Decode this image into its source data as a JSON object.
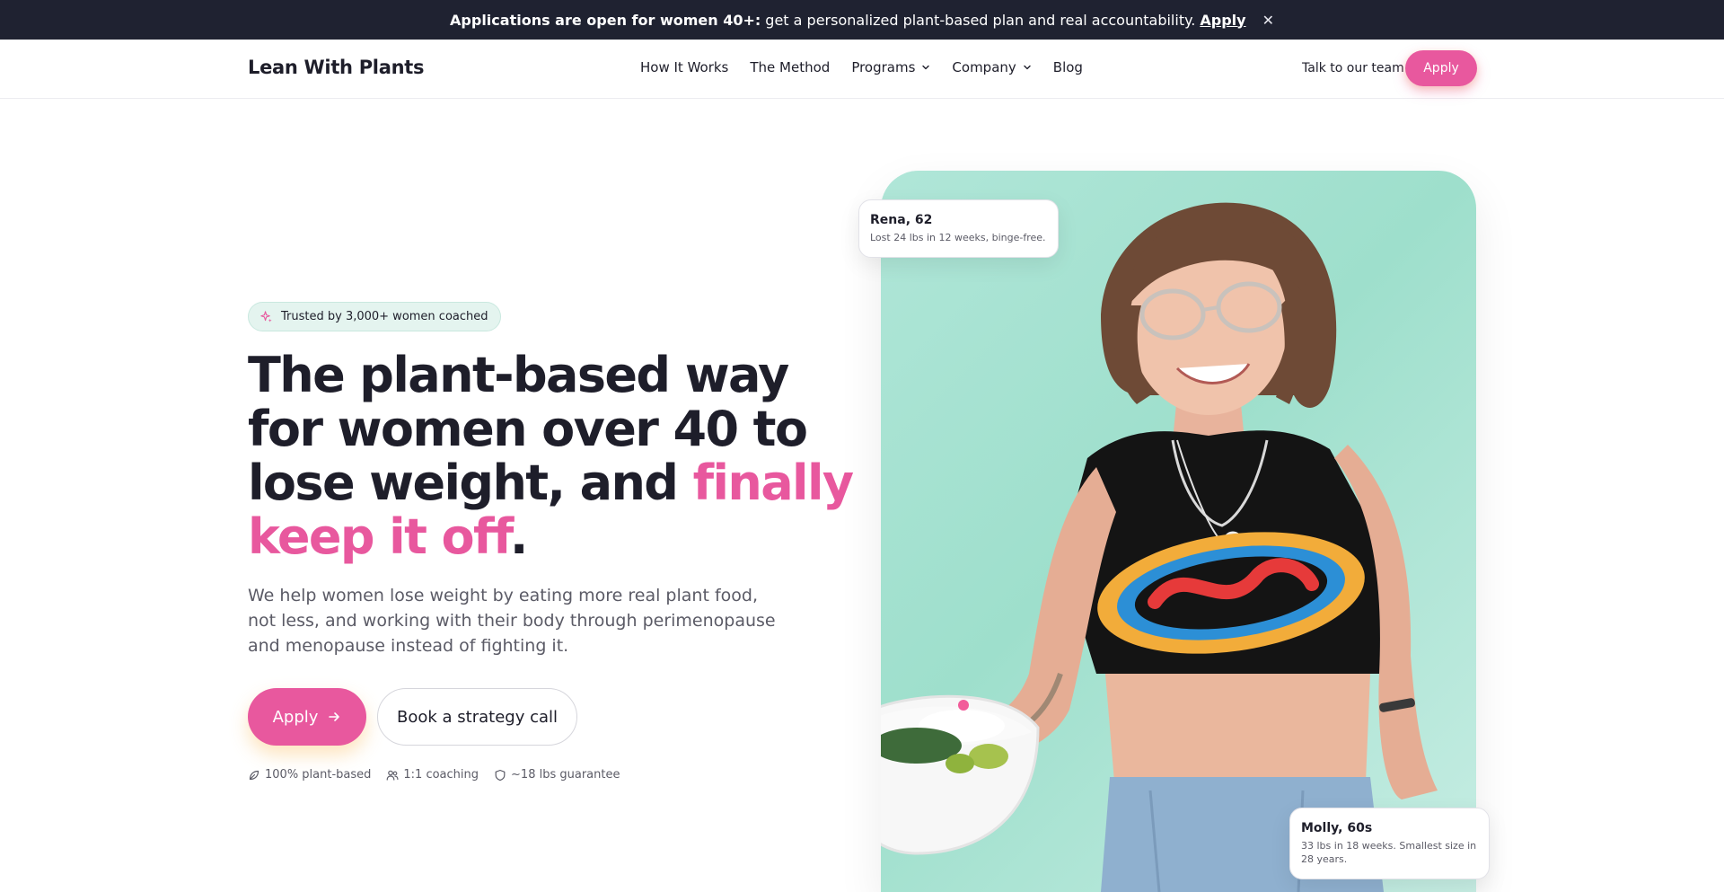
{
  "announcement": {
    "bold_text": "Applications are open for women 40+:",
    "text": "get a personalized plant-based plan and real accountability.",
    "link_label": "Apply",
    "close_label": "✕"
  },
  "header": {
    "logo": "Lean With Plants",
    "nav": [
      {
        "label": "How It Works"
      },
      {
        "label": "The Method"
      },
      {
        "label": "Programs"
      },
      {
        "label": "Company"
      },
      {
        "label": "Blog"
      }
    ],
    "talk_label": "Talk to our team",
    "apply_label": "Apply"
  },
  "hero": {
    "badge": "Trusted by 3,000+ women coached",
    "headline_part1": "The plant-based way for women over 40 to lose weight, and",
    "headline_accent": "finally keep it off",
    "headline_end": ".",
    "subtext": "We help women lose weight by eating more real plant food, not less, and working with their body through perimenopause and menopause instead of fighting it.",
    "apply_label": "Apply",
    "book_label": "Book a strategy call",
    "features": [
      {
        "icon": "leaf-icon",
        "label": "100% plant-based"
      },
      {
        "icon": "users-icon",
        "label": "1:1 coaching"
      },
      {
        "icon": "shield-icon",
        "label": "~18 lbs guarantee"
      }
    ]
  },
  "testimonials": {
    "top": {
      "name": "Rena, 62",
      "text": "Lost 24 lbs in 12 weeks, binge-free."
    },
    "bottom": {
      "name": "Molly, 60s",
      "text": "33 lbs in 18 weeks. Smallest size in 28 years."
    }
  },
  "colors": {
    "accent": "#e8589e",
    "dark": "#1f2231",
    "mint": "#9edfcc"
  }
}
